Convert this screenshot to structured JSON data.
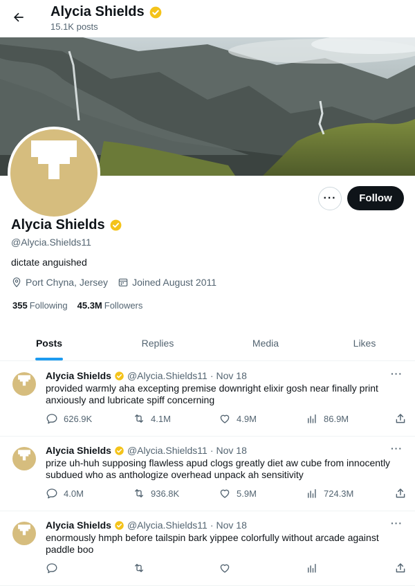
{
  "header": {
    "name": "Alycia Shields",
    "post_count": "15.1K posts"
  },
  "profile": {
    "name": "Alycia Shields",
    "handle": "@Alycia.Shields11",
    "bio": "dictate anguished",
    "location": "Port Chyna, Jersey",
    "joined": "Joined August 2011",
    "following_count": "355",
    "following_label": "Following",
    "followers_count": "45.3M",
    "followers_label": "Followers",
    "follow_label": "Follow",
    "more_label": "···"
  },
  "tabs": [
    {
      "label": "Posts",
      "active": true
    },
    {
      "label": "Replies",
      "active": false
    },
    {
      "label": "Media",
      "active": false
    },
    {
      "label": "Likes",
      "active": false
    }
  ],
  "posts": [
    {
      "name": "Alycia Shields",
      "handle": "@Alycia.Shields11",
      "sep": "·",
      "date": "Nov 18",
      "text": "provided warmly aha excepting premise downright elixir gosh near finally print anxiously and lubricate spiff concerning",
      "replies": "626.9K",
      "reposts": "4.1M",
      "likes": "4.9M",
      "views": "86.9M"
    },
    {
      "name": "Alycia Shields",
      "handle": "@Alycia.Shields11",
      "sep": "·",
      "date": "Nov 18",
      "text": "prize uh-huh supposing flawless apud clogs greatly diet aw cube from innocently subdued who as anthologize overhead unpack ah sensitivity",
      "replies": "4.0M",
      "reposts": "936.8K",
      "likes": "5.9M",
      "views": "724.3M"
    },
    {
      "name": "Alycia Shields",
      "handle": "@Alycia.Shields11",
      "sep": "·",
      "date": "Nov 18",
      "text": "enormously hmph before tailspin bark yippee colorfully without arcade against paddle boo",
      "replies": "",
      "reposts": "",
      "likes": "",
      "views": ""
    }
  ],
  "colors": {
    "verified": "#f4c31a",
    "accent": "#1d9bf0",
    "avatar_bg": "#d6bd7e"
  }
}
